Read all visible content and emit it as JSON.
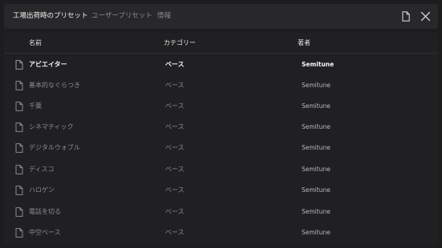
{
  "tabs": [
    {
      "label": "工場出荷時のプリセット",
      "active": true
    },
    {
      "label": "ユーザープリセット",
      "active": false
    },
    {
      "label": "情報",
      "active": false
    }
  ],
  "icons": {
    "new_preset": "document-icon",
    "close": "close-icon",
    "row": "document-icon"
  },
  "table": {
    "headers": [
      "名前",
      "カテゴリー",
      "著者"
    ],
    "rows": [
      {
        "name": "アビエイター",
        "category": "ベース",
        "author": "Semitune",
        "selected": true
      },
      {
        "name": "基本的なぐらつき",
        "category": "ベース",
        "author": "Semitune"
      },
      {
        "name": "千葉",
        "category": "ベース",
        "author": "Semitune"
      },
      {
        "name": "シネマティック",
        "category": "ベース",
        "author": "Semitune"
      },
      {
        "name": "デジタルウォブル",
        "category": "ベース",
        "author": "Semitune"
      },
      {
        "name": "ディスコ",
        "category": "ベース",
        "author": "Semitune"
      },
      {
        "name": "ハロゲン",
        "category": "ベース",
        "author": "Semitune"
      },
      {
        "name": "電話を切る",
        "category": "ベース",
        "author": "Semitune"
      },
      {
        "name": "中空ベース",
        "category": "ベース",
        "author": "Semitune"
      }
    ]
  },
  "colors": {
    "background": "#1d1d1f",
    "panel": "#202022",
    "topbar": "#28282a",
    "active_text": "#f2f2f2",
    "muted_text": "#8c8c90"
  }
}
